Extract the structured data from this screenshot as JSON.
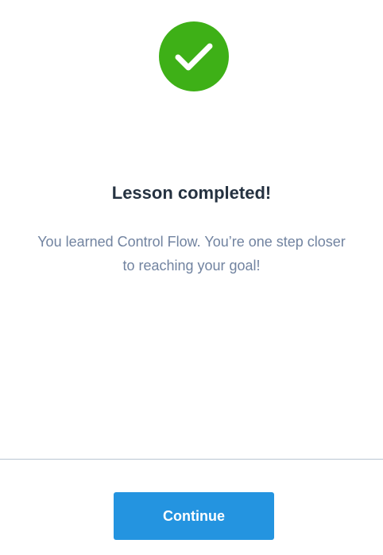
{
  "completion": {
    "icon": "checkmark-icon",
    "icon_color": "#3eb017",
    "title": "Lesson completed!",
    "message": "You learned Control Flow. You’re one step closer to reaching your goal!"
  },
  "footer": {
    "continue_label": "Continue",
    "button_color": "#2494e0"
  }
}
